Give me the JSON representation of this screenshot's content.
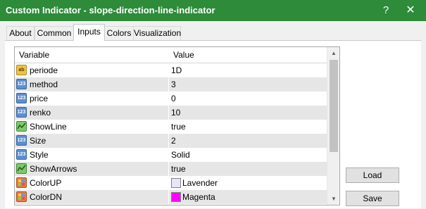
{
  "window": {
    "title": "Custom Indicator - slope-direction-line-indicator",
    "help_glyph": "?",
    "close_glyph": "✕"
  },
  "tabs": [
    {
      "label": "About"
    },
    {
      "label": "Common"
    },
    {
      "label": "Inputs",
      "active": true
    },
    {
      "label": "Colors"
    },
    {
      "label": "Visualization"
    }
  ],
  "grid": {
    "header_variable": "Variable",
    "header_value": "Value",
    "rows": [
      {
        "icon": "ab-string-icon",
        "name": "periode",
        "value": "1D"
      },
      {
        "icon": "number-icon",
        "name": "method",
        "value": "3"
      },
      {
        "icon": "number-icon",
        "name": "price",
        "value": "0"
      },
      {
        "icon": "number-icon",
        "name": "renko",
        "value": "10"
      },
      {
        "icon": "line-icon",
        "name": "ShowLine",
        "value": "true"
      },
      {
        "icon": "number-icon",
        "name": "Size",
        "value": "2"
      },
      {
        "icon": "number-icon",
        "name": "Style",
        "value": "Solid"
      },
      {
        "icon": "line-icon",
        "name": "ShowArrows",
        "value": "true"
      },
      {
        "icon": "color-icon",
        "name": "ColorUP",
        "value": "Lavender",
        "swatch": "#e6e6fa"
      },
      {
        "icon": "color-icon",
        "name": "ColorDN",
        "value": "Magenta",
        "swatch": "#ff00ff"
      }
    ]
  },
  "buttons": {
    "load": "Load",
    "save": "Save"
  },
  "colors": {
    "titlebar": "#2d8b3a",
    "row_alt": "#e6e6e6"
  }
}
